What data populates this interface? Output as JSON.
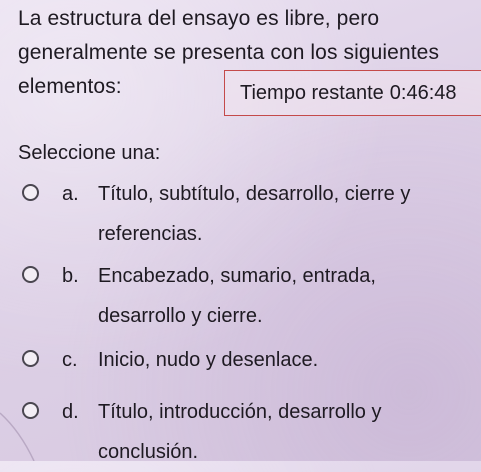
{
  "question": {
    "text": "La estructura del ensayo es libre, pero generalmente se presenta con los siguientes elementos:"
  },
  "timer": {
    "label": "Tiempo restante",
    "value": "0:46:48"
  },
  "instructions": "Seleccione una:",
  "options": [
    {
      "letter": "a.",
      "text": "Título, subtítulo, desarrollo, cierre y referencias."
    },
    {
      "letter": "b.",
      "text": "Encabezado, sumario, entrada, desarrollo y cierre."
    },
    {
      "letter": "c.",
      "text": "Inicio, nudo y desenlace."
    },
    {
      "letter": "d.",
      "text": "Título, introducción, desarrollo y conclusión."
    }
  ]
}
